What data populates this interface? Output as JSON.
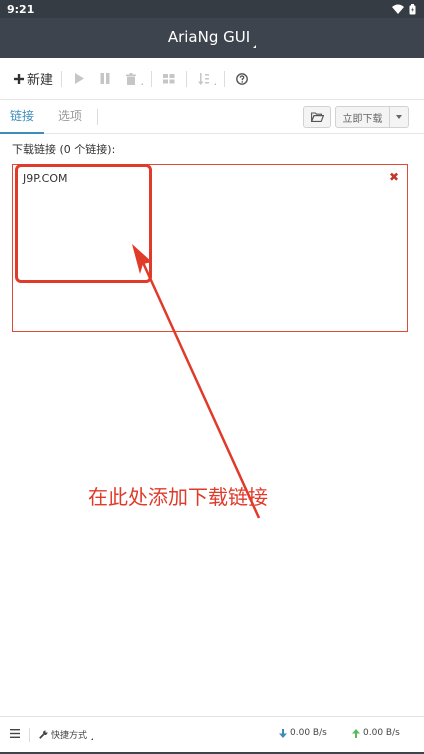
{
  "status_bar": {
    "time": "9:21"
  },
  "app_bar": {
    "title": "AriaNg GUI"
  },
  "toolbar": {
    "new_label": "新建"
  },
  "tabs": [
    {
      "label": "链接",
      "active": true
    },
    {
      "label": "选项",
      "active": false
    }
  ],
  "actions": {
    "start_download_label": "立即下载"
  },
  "form": {
    "links_label": "下载链接 (0 个链接):",
    "url_value": "J9P.COM"
  },
  "annotation": {
    "text": "在此处添加下载链接"
  },
  "footer": {
    "shortcut_label": "快捷方式",
    "download_speed": "0.00 B/s",
    "upload_speed": "0.00 B/s"
  },
  "colors": {
    "app_bar_bg": "#3e444d",
    "accent": "#3c8dbc",
    "annotation_red": "#e03a2b",
    "download_arrow": "#3c8dbc",
    "upload_arrow": "#5cb85c"
  },
  "icons": [
    "wifi-icon",
    "battery-icon",
    "plus-icon",
    "play-icon",
    "pause-icon",
    "trash-icon",
    "grid-icon",
    "sort-icon",
    "help-icon",
    "folder-open-icon",
    "close-icon",
    "menu-icon",
    "wrench-icon",
    "arrow-down-icon",
    "arrow-up-icon"
  ]
}
